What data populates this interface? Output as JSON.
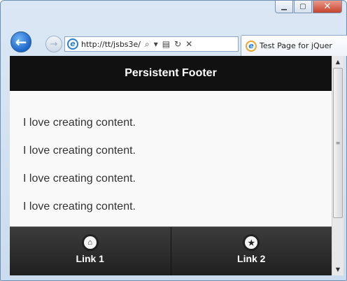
{
  "window": {
    "controls": {
      "minimize": "▁",
      "maximize": "▢",
      "close": "✕"
    }
  },
  "nav": {
    "back_icon": "←",
    "forward_icon": "→",
    "address": {
      "url": "http://tt/jsbs3e/",
      "icons": [
        "search-icon",
        "dropdown-icon",
        "compat-icon",
        "refresh-icon",
        "stop-icon"
      ],
      "icon_glyphs": {
        "search": "⌕",
        "dropdown": "▾",
        "compat": "▤",
        "refresh": "↻",
        "stop": "✕"
      }
    },
    "tab": {
      "title": "Test Page for jQuer"
    }
  },
  "page": {
    "header": {
      "title": "Persistent Footer"
    },
    "content": [
      "I love creating content.",
      "I love creating content.",
      "I love creating content.",
      "I love creating content."
    ],
    "footer": {
      "links": [
        {
          "label": "Link 1",
          "icon": "home-icon",
          "glyph": "⌂"
        },
        {
          "label": "Link 2",
          "icon": "star-icon",
          "glyph": "★"
        }
      ]
    }
  },
  "colors": {
    "header_bg": "#111111",
    "footer_bg": "#2a2a2a",
    "content_bg": "#f9f9f9",
    "text": "#333333"
  }
}
